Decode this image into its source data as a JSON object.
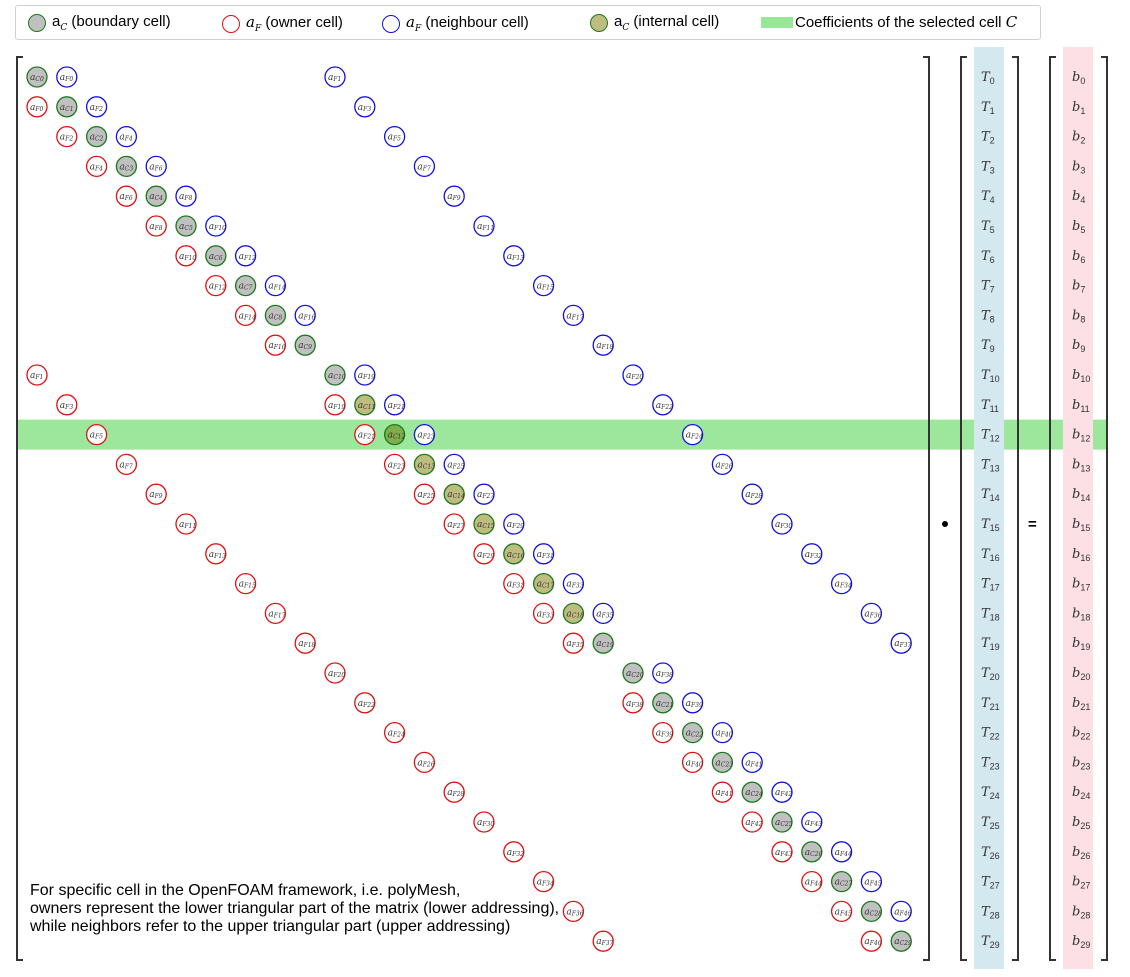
{
  "legend": {
    "items": [
      {
        "kind": "boundary",
        "prefix": "a",
        "sub": "C",
        "label": " (boundary cell)"
      },
      {
        "kind": "owner",
        "prefix": "a",
        "sub": "F",
        "label": " (owner cell)"
      },
      {
        "kind": "neighbour",
        "prefix": "a",
        "sub": "F",
        "label": " (neighbour cell)"
      },
      {
        "kind": "internal",
        "prefix": "a",
        "sub": "C",
        "label": " (internal cell)"
      },
      {
        "kind": "highlight",
        "label": "Coefficients of the selected cell ",
        "sym": "C"
      }
    ]
  },
  "colors": {
    "boundary_fill": "#c0c0c0",
    "internal_fill": "#bfbc80",
    "selected_fill": "#7fae4a",
    "diag_stroke": "#1a7a1a",
    "owner_stroke": "#e01010",
    "neighbour_stroke": "#1010e0",
    "highlight": "#98e698",
    "T_column": "#d4e8f0",
    "b_column": "#fde0e6"
  },
  "matrix": {
    "size": 30,
    "selected_row": 12,
    "internal_rows": [
      11,
      12,
      13,
      14,
      15,
      16,
      17,
      18
    ],
    "entries": [
      [
        [
          0,
          "C",
          "0"
        ],
        [
          1,
          "N",
          "0"
        ],
        [
          10,
          "N",
          "1"
        ]
      ],
      [
        [
          0,
          "O",
          "0"
        ],
        [
          1,
          "C",
          "1"
        ],
        [
          2,
          "N",
          "2"
        ],
        [
          11,
          "N",
          "3"
        ]
      ],
      [
        [
          1,
          "O",
          "2"
        ],
        [
          2,
          "C",
          "2"
        ],
        [
          3,
          "N",
          "4"
        ],
        [
          12,
          "N",
          "5"
        ]
      ],
      [
        [
          2,
          "O",
          "4"
        ],
        [
          3,
          "C",
          "3"
        ],
        [
          4,
          "N",
          "6"
        ],
        [
          13,
          "N",
          "7"
        ]
      ],
      [
        [
          3,
          "O",
          "6"
        ],
        [
          4,
          "C",
          "4"
        ],
        [
          5,
          "N",
          "8"
        ],
        [
          14,
          "N",
          "9"
        ]
      ],
      [
        [
          4,
          "O",
          "8"
        ],
        [
          5,
          "C",
          "5"
        ],
        [
          6,
          "N",
          "10"
        ],
        [
          15,
          "N",
          "11"
        ]
      ],
      [
        [
          5,
          "O",
          "10"
        ],
        [
          6,
          "C",
          "6"
        ],
        [
          7,
          "N",
          "12"
        ],
        [
          16,
          "N",
          "13"
        ]
      ],
      [
        [
          6,
          "O",
          "12"
        ],
        [
          7,
          "C",
          "7"
        ],
        [
          8,
          "N",
          "14"
        ],
        [
          17,
          "N",
          "15"
        ]
      ],
      [
        [
          7,
          "O",
          "14"
        ],
        [
          8,
          "C",
          "8"
        ],
        [
          9,
          "N",
          "16"
        ],
        [
          18,
          "N",
          "17"
        ]
      ],
      [
        [
          8,
          "O",
          "16"
        ],
        [
          9,
          "C",
          "9"
        ],
        [
          19,
          "N",
          "18"
        ]
      ],
      [
        [
          0,
          "O",
          "1"
        ],
        [
          10,
          "C",
          "10"
        ],
        [
          11,
          "N",
          "19"
        ],
        [
          20,
          "N",
          "20"
        ]
      ],
      [
        [
          1,
          "O",
          "3"
        ],
        [
          10,
          "O",
          "19"
        ],
        [
          11,
          "C",
          "11"
        ],
        [
          12,
          "N",
          "21"
        ],
        [
          21,
          "N",
          "22"
        ]
      ],
      [
        [
          2,
          "O",
          "5"
        ],
        [
          11,
          "O",
          "21"
        ],
        [
          12,
          "C",
          "12"
        ],
        [
          13,
          "N",
          "23"
        ],
        [
          22,
          "N",
          "24"
        ]
      ],
      [
        [
          3,
          "O",
          "7"
        ],
        [
          12,
          "O",
          "23"
        ],
        [
          13,
          "C",
          "13"
        ],
        [
          14,
          "N",
          "25"
        ],
        [
          23,
          "N",
          "26"
        ]
      ],
      [
        [
          4,
          "O",
          "9"
        ],
        [
          13,
          "O",
          "25"
        ],
        [
          14,
          "C",
          "14"
        ],
        [
          15,
          "N",
          "27"
        ],
        [
          24,
          "N",
          "28"
        ]
      ],
      [
        [
          5,
          "O",
          "11"
        ],
        [
          14,
          "O",
          "27"
        ],
        [
          15,
          "C",
          "15"
        ],
        [
          16,
          "N",
          "29"
        ],
        [
          25,
          "N",
          "30"
        ]
      ],
      [
        [
          6,
          "O",
          "13"
        ],
        [
          15,
          "O",
          "29"
        ],
        [
          16,
          "C",
          "16"
        ],
        [
          17,
          "N",
          "31"
        ],
        [
          26,
          "N",
          "32"
        ]
      ],
      [
        [
          7,
          "O",
          "15"
        ],
        [
          16,
          "O",
          "31"
        ],
        [
          17,
          "C",
          "17"
        ],
        [
          18,
          "N",
          "33"
        ],
        [
          27,
          "N",
          "34"
        ]
      ],
      [
        [
          8,
          "O",
          "17"
        ],
        [
          17,
          "O",
          "33"
        ],
        [
          18,
          "C",
          "18"
        ],
        [
          19,
          "N",
          "35"
        ],
        [
          28,
          "N",
          "36"
        ]
      ],
      [
        [
          9,
          "O",
          "18"
        ],
        [
          18,
          "O",
          "35"
        ],
        [
          19,
          "C",
          "19"
        ],
        [
          29,
          "N",
          "37"
        ]
      ],
      [
        [
          10,
          "O",
          "20"
        ],
        [
          20,
          "C",
          "20"
        ],
        [
          21,
          "N",
          "38"
        ]
      ],
      [
        [
          11,
          "O",
          "22"
        ],
        [
          20,
          "O",
          "38"
        ],
        [
          21,
          "C",
          "21"
        ],
        [
          22,
          "N",
          "39"
        ]
      ],
      [
        [
          12,
          "O",
          "24"
        ],
        [
          21,
          "O",
          "39"
        ],
        [
          22,
          "C",
          "22"
        ],
        [
          23,
          "N",
          "40"
        ]
      ],
      [
        [
          13,
          "O",
          "26"
        ],
        [
          22,
          "O",
          "40"
        ],
        [
          23,
          "C",
          "23"
        ],
        [
          24,
          "N",
          "41"
        ]
      ],
      [
        [
          14,
          "O",
          "28"
        ],
        [
          23,
          "O",
          "41"
        ],
        [
          24,
          "C",
          "24"
        ],
        [
          25,
          "N",
          "42"
        ]
      ],
      [
        [
          15,
          "O",
          "30"
        ],
        [
          24,
          "O",
          "42"
        ],
        [
          25,
          "C",
          "25"
        ],
        [
          26,
          "N",
          "43"
        ]
      ],
      [
        [
          16,
          "O",
          "32"
        ],
        [
          25,
          "O",
          "43"
        ],
        [
          26,
          "C",
          "26"
        ],
        [
          27,
          "N",
          "44"
        ]
      ],
      [
        [
          17,
          "O",
          "34"
        ],
        [
          26,
          "O",
          "44"
        ],
        [
          27,
          "C",
          "27"
        ],
        [
          28,
          "N",
          "45"
        ]
      ],
      [
        [
          18,
          "O",
          "36"
        ],
        [
          27,
          "O",
          "45"
        ],
        [
          28,
          "C",
          "28"
        ],
        [
          29,
          "N",
          "46"
        ]
      ],
      [
        [
          19,
          "O",
          "37"
        ],
        [
          28,
          "O",
          "46"
        ],
        [
          29,
          "C",
          "29"
        ]
      ]
    ]
  },
  "vector_T": {
    "symbol": "T",
    "count": 30
  },
  "vector_b": {
    "symbol": "b",
    "count": 30
  },
  "operators": {
    "dot": "•",
    "equals": "="
  },
  "note": "For specific cell in the OpenFOAM framework, i.e. polyMesh,\nowners represent the lower triangular part of the matrix (lower addressing),\nwhile neighbors refer to the upper triangular part (upper addressing)"
}
